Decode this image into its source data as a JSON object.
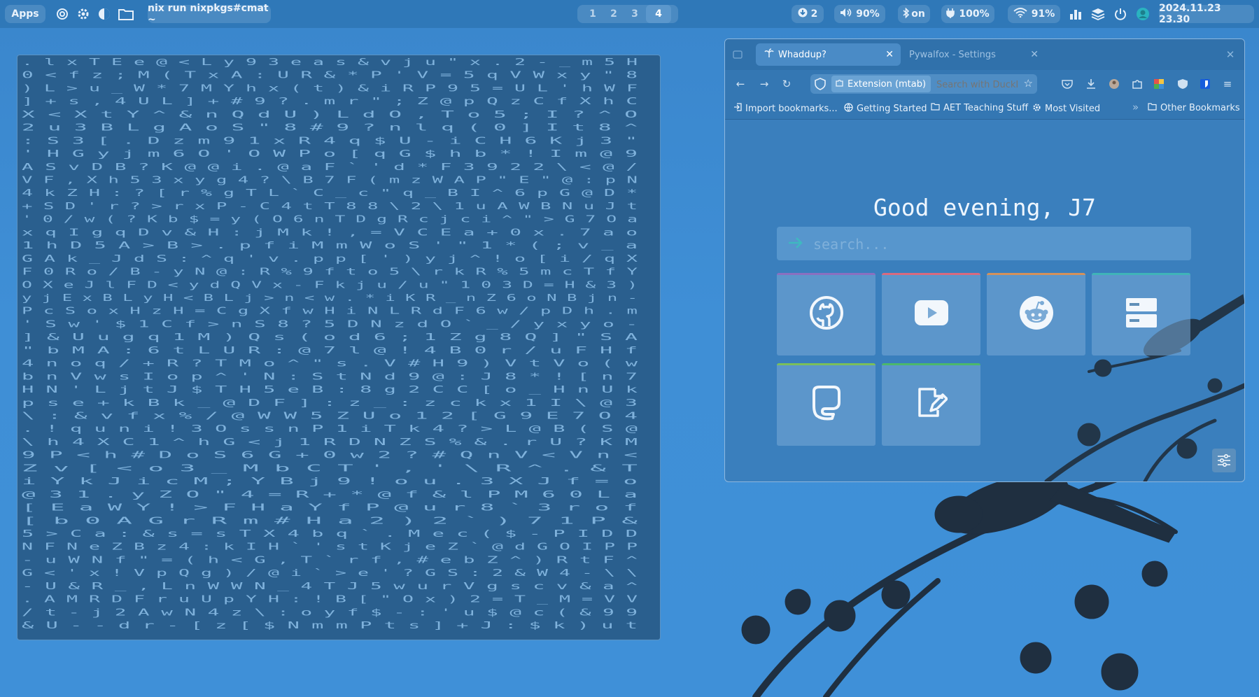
{
  "topbar": {
    "apps_label": "Apps",
    "command": "nix run nixpkgs#cmat ~",
    "workspaces": [
      "1",
      "2",
      "3",
      "4"
    ],
    "active_workspace": "4",
    "updates": "2",
    "volume": "90%",
    "bluetooth": "on",
    "battery": "100%",
    "wifi": "91%",
    "datetime": "2024.11.23 23.30",
    "icons": {
      "launcher": "openai-swirl-icon",
      "settings": "gear-icon",
      "theme": "half-moon-icon",
      "files": "folder-icon",
      "updates": "download-arrow-icon",
      "volume": "speaker-icon",
      "bluetooth": "bluetooth-icon",
      "battery": "battery-plug-icon",
      "wifi": "wifi-icon",
      "cpu": "bar-chart-icon",
      "layers": "layers-icon",
      "power": "power-icon",
      "avatar": "avatar-icon"
    }
  },
  "terminal": {
    "program": "cmatrix",
    "rows": [
      ". l   x   T E       e       @   < L   y 9 3       e a s           & v j u \" x           .     2 -   _     m         5       H     ",
      "0 <     f     z ;       M       (   T x   A : U       R & *           P '   V = 5 q         V         W x   y     \"         8       ",
      ") L   > u _ W         *       7   M Y   h x (         t ) &           i R   P 9 5           =         U L       '         h     W     F ",
      "] +   s , 4         U       L   ] +   # 9 ?         . m r           \" ;   Z @ p           Q         z         C f       X     h     C ",
      "X <   X t Y           ^       &   n     Q d         U ) L           d O   , T o           5         ;         I         ?     ^     O ",
      "2 u   3 B L           g       A   o     S \"         8 # 9           ? n   l q (           0         ]         I           t   8     ^ ",
      ": S   3 [ .   D         z     m     9 1             x R 4           q $   U - i           C   H 6             K   j           3     \" ",
      "' H   G y j   m           6   O     ' O             W P o           [ q   G $ h           b   * !             I     m         @     9 ",
      "A S   v D B ? K           @   @     i .             @ a F   `       '     d * F           3 9 2 2             \\   <           @     / ",
      "V F   , X h 5 3     x   y   g       4             ? \\ B   7 F (     m z W A           P \" E \"             @   :           p     N ",
      "4 k   Z H : ? [     r   %           g             T L `   C _ c     \" q _ B           I ^ 6 p             G   @           D     * ",
      "+ S   D ' r ? >     r   x P         -             C 4 t T 8 8       \\ 2 \\ 1           u A W B             N   u           J     t ",
      "' 0   / w ( ? K     b   $ =     y   (   O         6 n T D g R       c j c i           ^ \" > G                 7           O     a ",
      "x     q I g q D     v   & H     :   j   M         k ! , = V         C E   a           + 0 x .                 7           a     o ",
      "1     h D 5 A >     B   > .     p   f   i         M m   W o         S '   \"           1 * ( ;                 v           _     a ",
      "G     A k _ J d     S   : ^     q   '   v         . p   p [         ' ) y   j         ^ ! o [     i           /           q     X ",
      "F     0 R o / B -   y   N @     :   R   %         9 f   t o         5 \\ r   k         R % 5 m     c           T           f     Y ",
      "O     X e J l F D   < y d Q     V   x   -         F k   j u         / u \"   1         0 3 D =     H           &           3     ) ",
      "y     j E x B L y   H < B L     j   >   n         < w   . *         i K R   _         n Z 6 o     N   B j                 n     - ",
      "P     c S o x H     z H   =     C   g   X         f w   H i         N L R   d         F 6 w /     p   D h                 .     m ",
      "'     S w '   $ 1     C   f     >   n   S         8 ?   5 D         N z     d O       ` _ / y     x   y o                       - ",
      "]     & U u   g q     1   M     )   Q   s         ( o   d 6         ;   1   Z g       8 Q ]       \"   S A                         ",
      "\"     b M A   : 6     t   L     U   R   : @ 7     l @             !   4   B 0       r / u       F   H f                         ",
      "4     n o q   / +     R   ?     T   M   o ^ \"     s .             V   #   H 9       ) V t       V   o ( w                       ",
      "b     n V w   s I         o     p   ^   ' N : S   t N d           9   @   : J       8 * !           [ n 7                       ",
      "H     N '     L j         t     J   $ T H 5 e     B : 8           g   2   C C       [ o _           H n U   k                   ",
      "p     s e     +           k     B   k _ @ D       F ] :   z       _   :   z c       k x 1           I \\ @   3                   ",
      "\\ :   & v     f x         %   / @   W W   5       Z U     o       1   2   [         G   9           E 7 O   4                   ",
      ". !   q u     n           i   ! 3   O s   s       n P     1       i   T   k         4   ?           > L @ B (       S     @     ",
      "\\ h   4 X     C           1   ^ h G   < j   1     R D             N   Z   S         %             & . r U ?       K     M     ",
      "9 P   < h     #           D   o     S 6   G       + 0             w   2   ?         #             Q n V < V       n     <     ",
      "Z v   [ <     o           3         _   M         b C                 T   '         ,             ' \\ R ^ .       &     T     ",
      "i Y k J i     c           M ;   Y   B   j         9 !                 o u                         . 3 X J f       =     o     ",
      "@ 3 1   .     y           Z O   \" 4   =   R       + *   @             f &                         l P M 6 0       L     a     ",
      "[ E           a           W Y   ! >   F   H       a Y   f             P @           u           r 8 ` 3 r       o     f     ",
      "[ b           0           A G   r R   m   #       H a   2                                       ) 2 ` ) 7 1     P     &     ",
      "5 > C         a           : &   s     =   s       T X   4   b           q `         .           M e c ( $ - P I   D     D     ",
      "N F N         e           Z B   z 4   :   k       I H   `   '           s t       K j         e Z ` @ d G O I   P     P     ",
      "- u W         N           f \"   = (   h   <       G     ,   T           ` r f     , #         e b Z ^ ) R t     F     ^     ",
      "G < '         x           ! V   p Q   g   )       /     @   i           ` > e     ' ?         G S : 2 & W 4 -   \\     \\     ",
      "- U &         R           _ ,   L n   W   W       N     _   4           T J       5 w         u r V g s c v &   a     ^     ",
      ". A M         R           D F   r u   U   p       Y     H   :           ! B [     \" O         x ) 2 = T _ M =   V     V     ",
      "/ t -         j           2 A   w N   4   z       \\     :   o           y f     $ -         : ' u $ @ c ( &   9     9     ",
      "& U -         -           d r   - [ z   [   $       N     m   m           P t     s ] +       J : $ k ) u t               "
    ]
  },
  "browser": {
    "tabs": [
      {
        "title": "Whaddup?",
        "active": true,
        "icon": "palm-tree-icon"
      },
      {
        "title": "Pywalfox - Settings",
        "active": false
      }
    ],
    "url_identity": "Extension (mtab)",
    "search_placeholder": "Search with DuckDuckGo",
    "bookmarks": [
      {
        "label": "Import bookmarks...",
        "icon": "import-icon"
      },
      {
        "label": "Getting Started",
        "icon": "globe-icon"
      },
      {
        "label": "AET Teaching Stuff",
        "icon": "folder-icon"
      },
      {
        "label": "Most Visited",
        "icon": "gear-icon"
      }
    ],
    "other_bookmarks": "Other Bookmarks",
    "newtab": {
      "greeting": "Good evening, J7",
      "search_placeholder": "search...",
      "shortcuts": [
        {
          "name": "GitHub",
          "icon": "github-icon",
          "color": "#8a6fc0"
        },
        {
          "name": "YouTube",
          "icon": "youtube-icon",
          "color": "#d96a7f"
        },
        {
          "name": "Reddit",
          "icon": "reddit-icon",
          "color": "#d4915a"
        },
        {
          "name": "Storage",
          "icon": "server-icon",
          "color": "#3fb4b8"
        },
        {
          "name": "Mastodon",
          "icon": "mastodon-icon",
          "color": "#7bbf5a"
        },
        {
          "name": "Notes",
          "icon": "edit-note-icon",
          "color": "#4cb86b"
        }
      ]
    }
  },
  "colors": {
    "desktop": "#3f8fd6",
    "topbar": "#2f78b8",
    "terminal_bg": "#2a5f8e",
    "matrix_text": "#7fb2dc"
  }
}
